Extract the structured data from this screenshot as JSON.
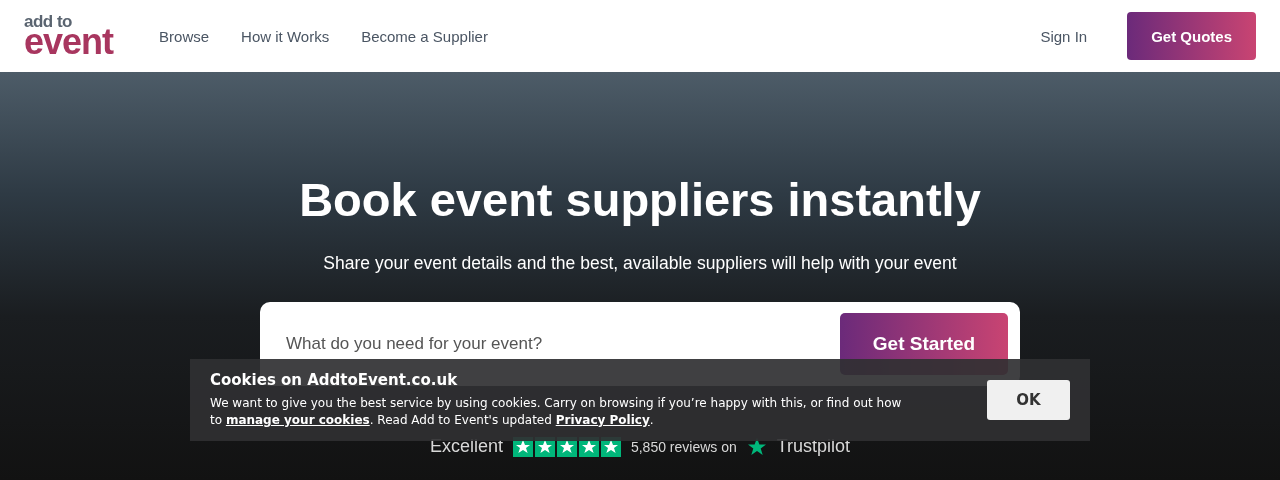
{
  "header": {
    "logo": {
      "top": "add to",
      "bottom": "event"
    },
    "nav": [
      {
        "label": "Browse"
      },
      {
        "label": "How it Works"
      },
      {
        "label": "Become a Supplier"
      }
    ],
    "sign_in": "Sign In",
    "cta": "Get Quotes"
  },
  "hero": {
    "title": "Book event suppliers instantly",
    "subtitle": "Share your event details and the best, available suppliers will help with your event",
    "search": {
      "placeholder": "What do you need for your event?",
      "button": "Get Started"
    },
    "rating": {
      "label": "Excellent",
      "stars": 5,
      "reviews": "5,850 reviews on",
      "brand": "Trustpilot"
    }
  },
  "cookie_banner": {
    "title": "Cookies on AddtoEvent.co.uk",
    "text_before": "We want to give you the best service by using cookies. Carry on browsing if you’re happy with this, or find out how to",
    "link1": "manage your cookies",
    "text_middle": ". Read Add to Event's updated",
    "link2": "Privacy Policy",
    "text_after": ".",
    "button": "OK"
  }
}
